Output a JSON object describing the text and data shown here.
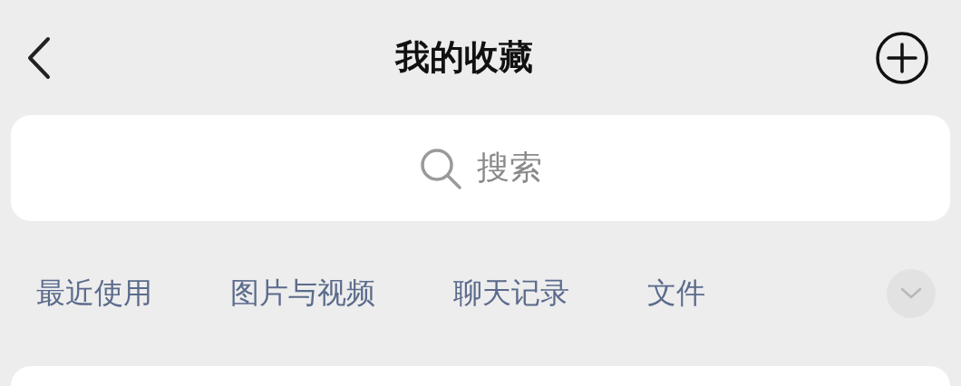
{
  "header": {
    "title": "我的收藏"
  },
  "search": {
    "placeholder": "搜索"
  },
  "categories": [
    {
      "label": "最近使用"
    },
    {
      "label": "图片与视频"
    },
    {
      "label": "聊天记录"
    },
    {
      "label": "文件"
    }
  ]
}
